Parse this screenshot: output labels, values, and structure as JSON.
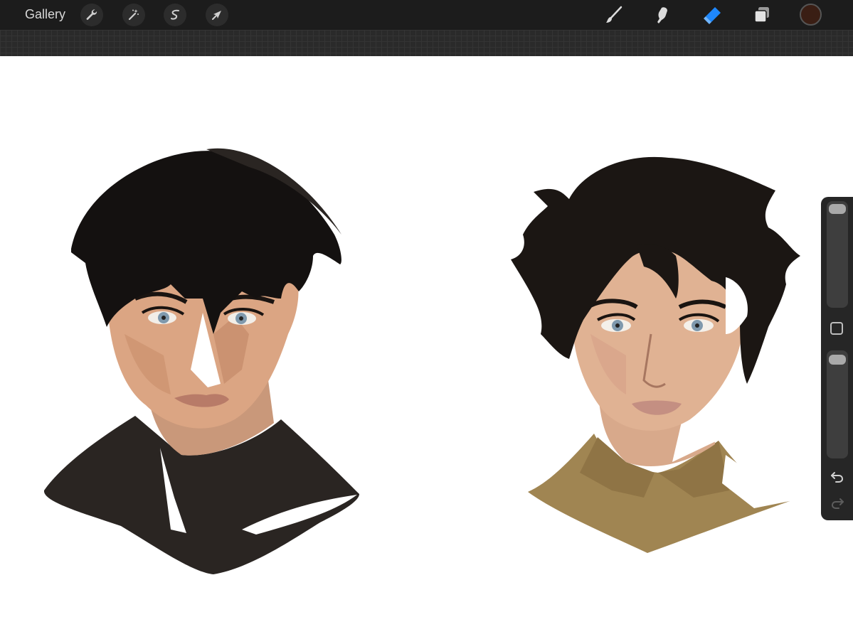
{
  "toolbar": {
    "gallery_label": "Gallery",
    "left_tools": [
      "wrench-icon",
      "magic-wand-icon",
      "selection-icon",
      "transform-arrow-icon"
    ],
    "right_tools": [
      "brush-icon",
      "smudge-icon",
      "eraser-icon",
      "layers-icon"
    ],
    "active_tool": "eraser",
    "active_color": "#3a1e14",
    "accent_color": "#1e88ff"
  },
  "sidebar": {
    "controls": [
      "brush-size-slider",
      "modify-button",
      "opacity-slider",
      "undo-button",
      "redo-button"
    ]
  },
  "canvas": {
    "content": [
      "portrait-left",
      "portrait-right"
    ]
  }
}
